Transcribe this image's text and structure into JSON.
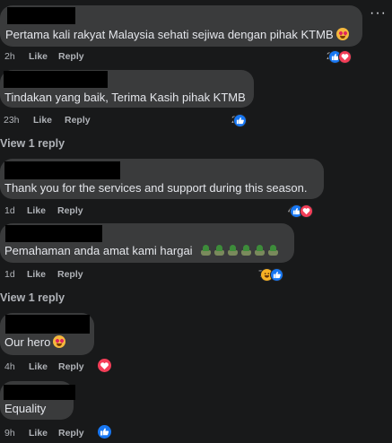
{
  "more_menu": "···",
  "comments": [
    {
      "text": "Pertama kali rakyat Malaysia sehati sejiwa dengan pihak KTMB",
      "time": "2h",
      "like": "Like",
      "reply": "Reply",
      "count": "2",
      "reactions": [
        "like-icon",
        "love-icon"
      ],
      "emoji": "smiling-face-with-heart-eyes"
    },
    {
      "text": "Tindakan yang baik, Terima Kasih pihak KTMB",
      "time": "23h",
      "like": "Like",
      "reply": "Reply",
      "count": "2",
      "reactions": [
        "like-icon"
      ]
    },
    {
      "text": "Thank you for the services and support during this season.",
      "time": "1d",
      "like": "Like",
      "reply": "Reply",
      "count": "4",
      "reactions": [
        "like-icon",
        "love-icon"
      ]
    },
    {
      "text": "Pemahaman anda amat kami hargai",
      "time": "1d",
      "like": "Like",
      "reply": "Reply",
      "count": "7",
      "reactions": [
        "haha-icon",
        "like-icon"
      ],
      "emoji": "potted-plant-x6"
    },
    {
      "text": "Our hero",
      "time": "4h",
      "like": "Like",
      "reply": "Reply",
      "count": "",
      "reactions": [
        "love-icon"
      ],
      "emoji": "smiling-face-with-heart-eyes"
    },
    {
      "text": "Equality",
      "time": "9h",
      "like": "Like",
      "reply": "Reply",
      "count": "",
      "reactions": [
        "like-icon"
      ]
    }
  ],
  "view_replies_1": "View 1 reply",
  "view_replies_2": "View 1 reply",
  "colors": {
    "background": "#18191a",
    "bubble": "#3a3b3c",
    "like": "#1877f2",
    "love": "#f33e58"
  }
}
